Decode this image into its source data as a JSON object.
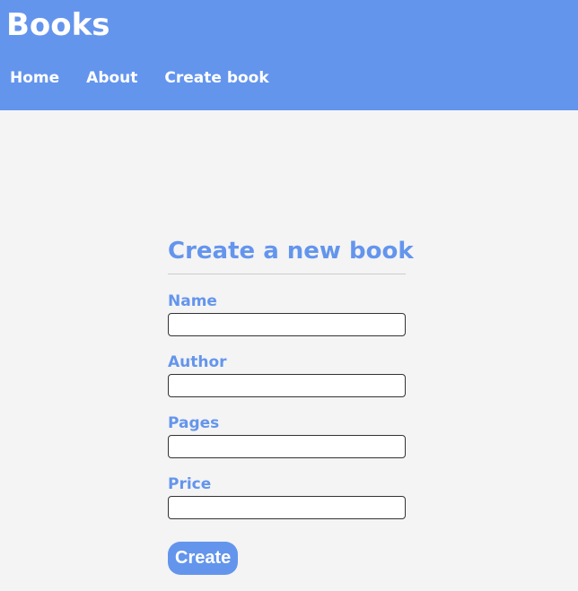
{
  "header": {
    "brand": "Books",
    "nav": [
      {
        "label": "Home"
      },
      {
        "label": "About"
      },
      {
        "label": "Create book"
      }
    ]
  },
  "form": {
    "title": "Create a new book",
    "fields": [
      {
        "label": "Name",
        "value": "",
        "placeholder": ""
      },
      {
        "label": "Author",
        "value": "",
        "placeholder": ""
      },
      {
        "label": "Pages",
        "value": "",
        "placeholder": ""
      },
      {
        "label": "Price",
        "value": "",
        "placeholder": ""
      }
    ],
    "submit_label": "Create"
  },
  "colors": {
    "accent": "#6495ed",
    "background": "#f4f4f4",
    "header_text": "#ffffff"
  }
}
